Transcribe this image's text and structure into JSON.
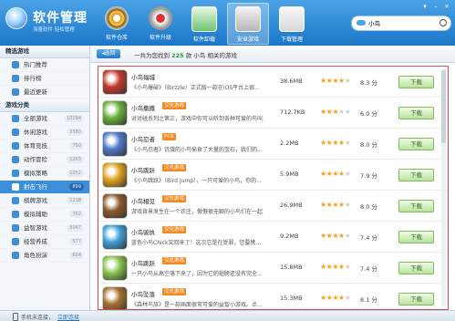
{
  "header": {
    "title": "软件管理",
    "subtitle": "海量软件 轻松管理",
    "nav": [
      {
        "label": "软件仓库",
        "icon": "disc-icon"
      },
      {
        "label": "软件升级",
        "icon": "update-icon"
      },
      {
        "label": "软件卸载",
        "icon": "recycle-icon"
      },
      {
        "label": "安卓游戏",
        "icon": "android-icon"
      },
      {
        "label": "下载管理",
        "icon": "download-icon"
      }
    ],
    "search": {
      "value": "小鸟"
    }
  },
  "sidebar": {
    "section1": "精选游戏",
    "featured": [
      {
        "label": "热门推荐"
      },
      {
        "label": "排行榜"
      },
      {
        "label": "最近更新"
      }
    ],
    "section2": "游戏分类",
    "categories": [
      {
        "label": "全部游戏",
        "count": "10294"
      },
      {
        "label": "休闲游戏",
        "count": "3580"
      },
      {
        "label": "体育竞技",
        "count": "750"
      },
      {
        "label": "动作冒险",
        "count": "1203"
      },
      {
        "label": "模拟策略",
        "count": "1052"
      },
      {
        "label": "射击飞行",
        "count": "899"
      },
      {
        "label": "棋牌游戏",
        "count": "1218"
      },
      {
        "label": "模拟辅助",
        "count": "702"
      },
      {
        "label": "益智游戏",
        "count": "3047"
      },
      {
        "label": "经营养成",
        "count": "577"
      },
      {
        "label": "角色扮演",
        "count": "604"
      }
    ]
  },
  "toolbar": {
    "back": "返回",
    "found_prefix": "一共为您找到",
    "found_count": "225",
    "found_suffix": "款 小鸟 相关的游戏"
  },
  "list": [
    {
      "name": "小鸟福城",
      "tag": "",
      "desc": "《小鸟爆破》（Birzzle）正式版一款在iOS平台上很...",
      "size": "38.6MB",
      "stars": 4,
      "score": "8.3 分",
      "button": "下载",
      "color": "#c23b2e"
    },
    {
      "name": "小鸟撒撒",
      "tag": "汉化游戏",
      "desc": "对对碰系列之第三，游戏中你可以听到各种可爱的鸟叫...",
      "size": "712.7KB",
      "stars": 3,
      "score": "6.0 分",
      "button": "下载",
      "color": "#6ab03a"
    },
    {
      "name": "小鸟忍者",
      "tag": "PC6",
      "desc": "《小鸟忍者》饥饿的小鸟偷食了大量的宝石，我们的...",
      "size": "2.2MB",
      "stars": 4,
      "score": "8.0 分",
      "button": "下载",
      "color": "#4f78c9"
    },
    {
      "name": "小鸟跳跃",
      "tag": "汉化游戏",
      "desc": "《小鸟跳跃》（Bird Jump），一只可爱的小鸟，你的...",
      "size": "5.9MB",
      "stars": 4,
      "score": "7.9 分",
      "button": "下载",
      "color": "#e0a11b"
    },
    {
      "name": "小鸟相见",
      "tag": "汉化游戏",
      "desc": "游戏背景发生在一个农庄，傲傲很无聊的小鸟们在一起...",
      "size": "26.9MB",
      "stars": 4,
      "score": "8.0 分",
      "button": "下载",
      "color": "#8b5a2b"
    },
    {
      "name": "小鸟骏执",
      "tag": "汉化游戏",
      "desc": "蓝色小鸟Chick又回来了！这次它是在受罪，您要携...",
      "size": "9.2MB",
      "stars": 4,
      "score": "7.4 分",
      "button": "下载",
      "color": "#3ea0d8"
    },
    {
      "name": "小鸟跳跃",
      "tag": "汉化游戏",
      "desc": "一只小鸟从高空落下来了，因为它的翅膀还没有完全...",
      "size": "15.8MB",
      "stars": 4,
      "score": "7.4 分",
      "button": "下载",
      "color": "#88c34a"
    },
    {
      "name": "小鸟坠落",
      "tag": "汉化游戏",
      "desc": "《森林鸟族》是一款画面很常可爱的益智小游戏。点...",
      "size": "15.3MB",
      "stars": 4,
      "score": "8.1 分",
      "button": "下载",
      "color": "#a6702f"
    }
  ],
  "status": {
    "text": "手机未连接，",
    "link": "立即连接"
  }
}
